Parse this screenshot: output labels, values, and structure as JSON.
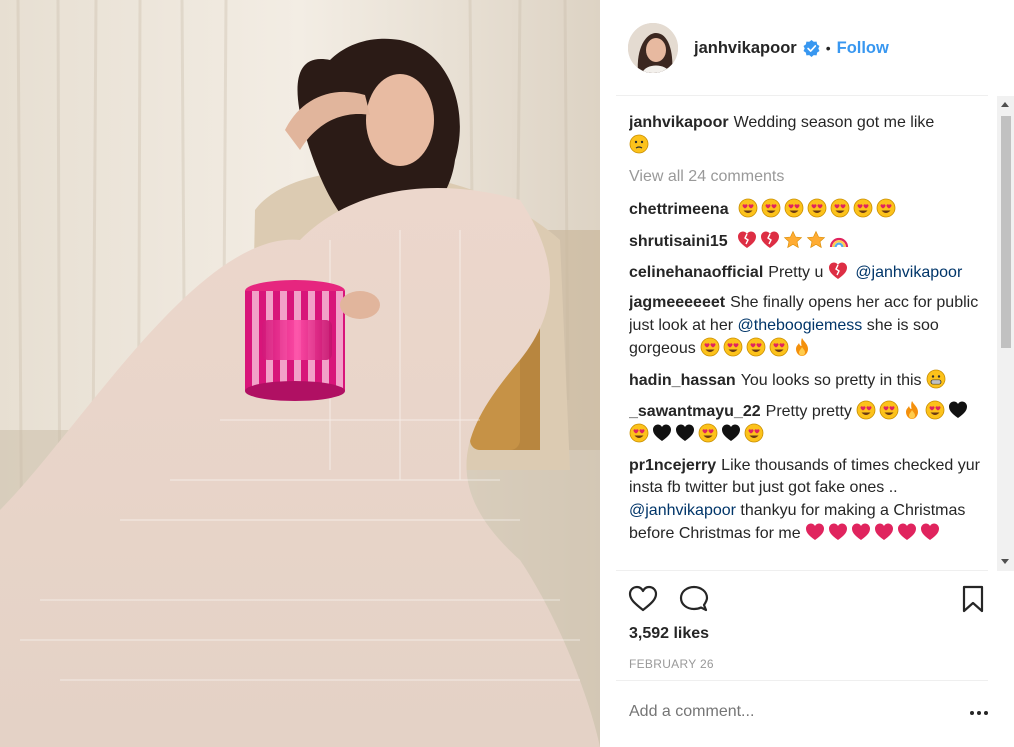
{
  "post": {
    "username": "janhvikapoor",
    "follow_label": "Follow",
    "separator": "•",
    "verified_icon": "verified-badge-icon",
    "caption_user": "janhvikapoor",
    "caption_text": "Wedding season got me like",
    "view_all": "View all 24 comments",
    "likes": "3,592 likes",
    "date": "FEBRUARY 26",
    "add_comment_placeholder": "Add a comment..."
  },
  "comments": [
    {
      "user": "chettrimeena",
      "text": "",
      "emoji": [
        "heart-eyes",
        "heart-eyes",
        "heart-eyes",
        "heart-eyes",
        "heart-eyes",
        "heart-eyes",
        "heart-eyes"
      ]
    },
    {
      "user": "shrutisaini15",
      "text": "",
      "emoji": [
        "broken-heart",
        "broken-heart",
        "star",
        "star",
        "rainbow"
      ]
    },
    {
      "user": "celinehanaofficial",
      "text": "Pretty u",
      "emoji": [
        "broken-heart"
      ],
      "mention": "@janhvikapoor"
    },
    {
      "user": "jagmeeeeeet",
      "text": "She finally opens her acc for public just look at her",
      "mention": "@theboogiemess",
      "text2": "she is soo gorgeous",
      "emoji": [
        "heart-eyes",
        "heart-eyes",
        "heart-eyes",
        "heart-eyes",
        "fire"
      ]
    },
    {
      "user": "hadin_hassan",
      "text": "You looks so pretty in this",
      "emoji": [
        "grin"
      ]
    },
    {
      "user": "_sawantmayu_22",
      "text": "Pretty pretty",
      "emoji": [
        "heart-eyes",
        "heart-eyes",
        "fire",
        "heart-eyes",
        "black-heart",
        "heart-eyes",
        "black-heart",
        "black-heart",
        "heart-eyes",
        "black-heart",
        "heart-eyes"
      ]
    },
    {
      "user": "pr1ncejerry",
      "text": "Like thousands of times checked yur insta fb twitter but just got fake ones ..",
      "mention": "@janhvikapoor",
      "text2": "thankyu for making a Christmas before Christmas for me",
      "emoji": [
        "heart",
        "heart",
        "heart",
        "heart",
        "heart",
        "heart"
      ]
    }
  ],
  "icons": {
    "like": "heart-outline-icon",
    "comment": "speech-bubble-icon",
    "save": "bookmark-icon",
    "more": "more-horizontal-icon"
  },
  "colors": {
    "link": "#3897f0",
    "mention": "#003569",
    "muted": "#999999",
    "verified": "#3897f0"
  }
}
